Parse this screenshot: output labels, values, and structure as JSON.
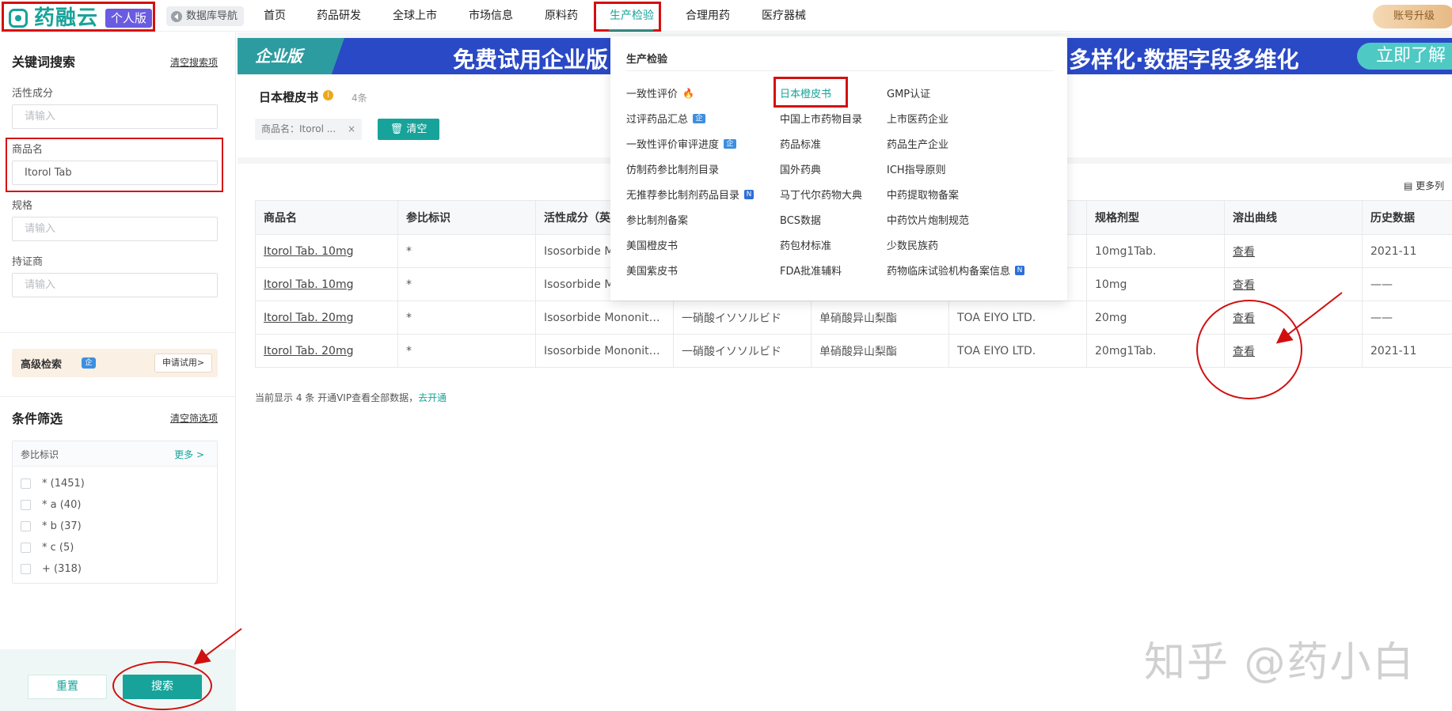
{
  "brand": {
    "name": "药融云",
    "edition": "个人版"
  },
  "topnav": {
    "db_nav_label": "数据库导航",
    "items": [
      "首页",
      "药品研发",
      "全球上市",
      "市场信息",
      "原料药",
      "生产检验",
      "合理用药",
      "医疗器械"
    ],
    "active": "生产检验",
    "upgrade_label": "账号升级"
  },
  "left_panel": {
    "keyword_title": "关键词搜索",
    "clear_search": "清空搜索项",
    "fields": [
      {
        "label": "活性成分",
        "value": "",
        "placeholder": "请输入"
      },
      {
        "label": "商品名",
        "value": "Itorol Tab",
        "placeholder": "请输入"
      },
      {
        "label": "规格",
        "value": "",
        "placeholder": "请输入"
      },
      {
        "label": "持证商",
        "value": "",
        "placeholder": "请输入"
      }
    ],
    "advanced": {
      "label": "高级检索",
      "badge": "企",
      "apply": "申请试用>"
    },
    "filter_title": "条件筛选",
    "clear_filter": "清空筛选项",
    "filter_group": {
      "title": "参比标识",
      "more": "更多 >",
      "options": [
        "* (1451)",
        "* a (40)",
        "* b (37)",
        "* c (5)",
        "+ (318)"
      ]
    },
    "reset_label": "重置",
    "search_label": "搜索"
  },
  "banner": {
    "tag": "企业版",
    "text_left": "免费试用企业版",
    "text_right": "多样化·数据字段多维化",
    "cta": "立即了解"
  },
  "results": {
    "title": "日本橙皮书",
    "info_icon": "i",
    "count": "4条",
    "chip": "商品名：Itorol ...",
    "chip_close": "×",
    "clear_label": "清空",
    "more_columns": "更多列",
    "columns": [
      "商品名",
      "参比标识",
      "活性成分（英",
      "",
      "",
      "",
      "规格剂型",
      "溶出曲线",
      "历史数据"
    ],
    "rows": [
      [
        "Itorol Tab. 10mg",
        "*",
        "Isosorbide Mononit…",
        "",
        "",
        "",
        "10mg1Tab.",
        "查看",
        "2021-11"
      ],
      [
        "Itorol Tab. 10mg",
        "*",
        "Isosorbide Mononit…",
        "",
        "",
        "",
        "10mg",
        "查看",
        "——"
      ],
      [
        "Itorol Tab. 20mg",
        "*",
        "Isosorbide Mononit…",
        "一硝酸イソソルビド",
        "单硝酸异山梨酯",
        "TOA EIYO LTD.",
        "20mg",
        "查看",
        "——"
      ],
      [
        "Itorol Tab. 20mg",
        "*",
        "Isosorbide Mononit…",
        "一硝酸イソソルビド",
        "单硝酸异山梨酯",
        "TOA EIYO LTD.",
        "20mg1Tab.",
        "查看",
        "2021-11"
      ]
    ],
    "footnote_text": "当前显示 4 条 开通VIP查看全部数据，",
    "footnote_link": "去开通"
  },
  "dropdown": {
    "title": "生产检验",
    "col1": [
      {
        "label": "一致性评价",
        "tag": "🔥",
        "tagtype": "fire"
      },
      {
        "label": "过评药品汇总",
        "tag": "企",
        "tagtype": "qi"
      },
      {
        "label": "一致性评价审评进度",
        "tag": "企",
        "tagtype": "qi"
      },
      {
        "label": "仿制药参比制剂目录",
        "tag": "",
        "tagtype": ""
      },
      {
        "label": "无推荐参比制剂药品目录",
        "tag": "N",
        "tagtype": "n"
      },
      {
        "label": "参比制剂备案",
        "tag": "",
        "tagtype": ""
      },
      {
        "label": "美国橙皮书",
        "tag": "",
        "tagtype": ""
      },
      {
        "label": "美国紫皮书",
        "tag": "",
        "tagtype": ""
      }
    ],
    "col2": [
      "日本橙皮书",
      "中国上市药物目录",
      "药品标准",
      "国外药典",
      "马丁代尔药物大典",
      "BCS数据",
      "药包材标准",
      "FDA批准辅料"
    ],
    "col3": [
      {
        "label": "GMP认证",
        "tag": ""
      },
      {
        "label": "上市医药企业",
        "tag": ""
      },
      {
        "label": "药品生产企业",
        "tag": ""
      },
      {
        "label": "ICH指导原则",
        "tag": ""
      },
      {
        "label": "中药提取物备案",
        "tag": ""
      },
      {
        "label": "中药饮片炮制规范",
        "tag": ""
      },
      {
        "label": "少数民族药",
        "tag": ""
      },
      {
        "label": "药物临床试验机构备案信息",
        "tag": "N"
      }
    ],
    "highlighted": "日本橙皮书"
  },
  "watermark": "知乎 @药小白",
  "colors": {
    "accent": "#17a39a",
    "annotation": "#d60f0f",
    "banner": "#2a49c6"
  }
}
